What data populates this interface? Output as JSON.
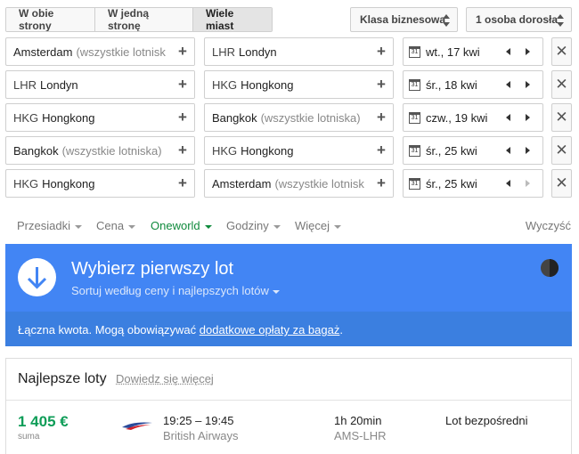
{
  "trip_type": {
    "options": [
      "W obie strony",
      "W jedną stronę",
      "Wiele miast"
    ],
    "active": "Wiele miast"
  },
  "cabin_class": "Klasa biznesowa",
  "passengers": "1 osoba dorosła",
  "legs": [
    {
      "from_main": "Amsterdam",
      "from_sub": "(wszystkie lotnisk",
      "to_code": "LHR",
      "to_main": "Londyn",
      "date": "wt., 17 kwi"
    },
    {
      "from_code": "LHR",
      "from_main": "Londyn",
      "to_code": "HKG",
      "to_main": "Hongkong",
      "date": "śr., 18 kwi"
    },
    {
      "from_code": "HKG",
      "from_main": "Hongkong",
      "to_main": "Bangkok",
      "to_sub": "(wszystkie lotniska)",
      "date": "czw., 19 kwi"
    },
    {
      "from_main": "Bangkok",
      "from_sub": "(wszystkie lotniska)",
      "to_code": "HKG",
      "to_main": "Hongkong",
      "date": "śr., 25 kwi"
    },
    {
      "from_code": "HKG",
      "from_main": "Hongkong",
      "to_main": "Amsterdam",
      "to_sub": "(wszystkie lotnisk",
      "date": "śr., 25 kwi"
    }
  ],
  "calendar_icon_text": "31",
  "filters": {
    "items": [
      "Przesiadki",
      "Cena",
      "Oneworld",
      "Godziny",
      "Więcej"
    ],
    "active": "Oneworld",
    "clear": "Wyczyść"
  },
  "banner": {
    "title": "Wybierz pierwszy lot",
    "sort_link": "Sortuj według ceny i najlepszych lotów",
    "note_prefix": "Łączna kwota. Mogą obowiązywać ",
    "note_link": "dodatkowe opłaty za bagaż",
    "note_suffix": ".",
    "colors": {
      "primary": "#4285f4",
      "note_bg": "#3b7fe0"
    }
  },
  "results": {
    "heading": "Najlepsze loty",
    "learn_more": "Dowiedz się więcej",
    "flights": [
      {
        "price": "1 405 €",
        "price_label": "suma",
        "times": "19:25 – 19:45",
        "airline": "British Airways",
        "duration": "1h 20min",
        "route": "AMS-LHR",
        "stops": "Lot bezpośredni",
        "logo": "british-airways-logo"
      }
    ]
  },
  "colors": {
    "price_green": "#0f9d58",
    "filter_active": "#0f8a3c"
  }
}
